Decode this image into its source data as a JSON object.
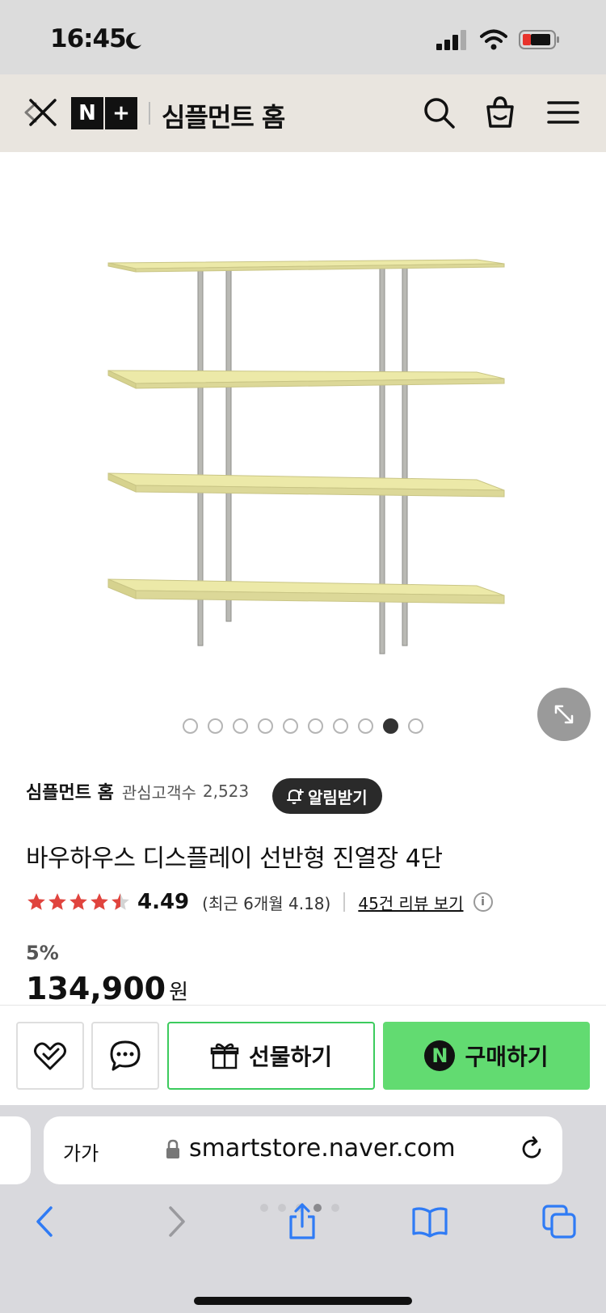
{
  "status_bar": {
    "time": "16:45"
  },
  "header": {
    "logo_n": "N",
    "logo_plus": "+",
    "title": "심플먼트 홈"
  },
  "gallery": {
    "image_count": 10,
    "active_index": 8
  },
  "store": {
    "name": "심플먼트 홈",
    "followers_label": "관심고객수",
    "followers_count": "2,523",
    "alarm_label": "알림받기"
  },
  "product": {
    "title": "바우하우스 디스플레이 선반형 진열장 4단",
    "rating": "4.49",
    "rating_stars": 4.49,
    "recent_rating": "(최근 6개월 4.18)",
    "review_link": "45건 리뷰 보기",
    "discount": "5%",
    "price": "134,900",
    "price_unit": "원"
  },
  "actions": {
    "gift_label": "선물하기",
    "buy_badge": "N",
    "buy_label": "구매하기"
  },
  "browser": {
    "text_size_label": "가가",
    "url": "smartstore.naver.com"
  },
  "colors": {
    "star": "#e0443e",
    "buy_green": "#62db71",
    "gift_border": "#3ccb5d",
    "shelf": "#ece9a8",
    "header_bg": "#e9e5df"
  }
}
